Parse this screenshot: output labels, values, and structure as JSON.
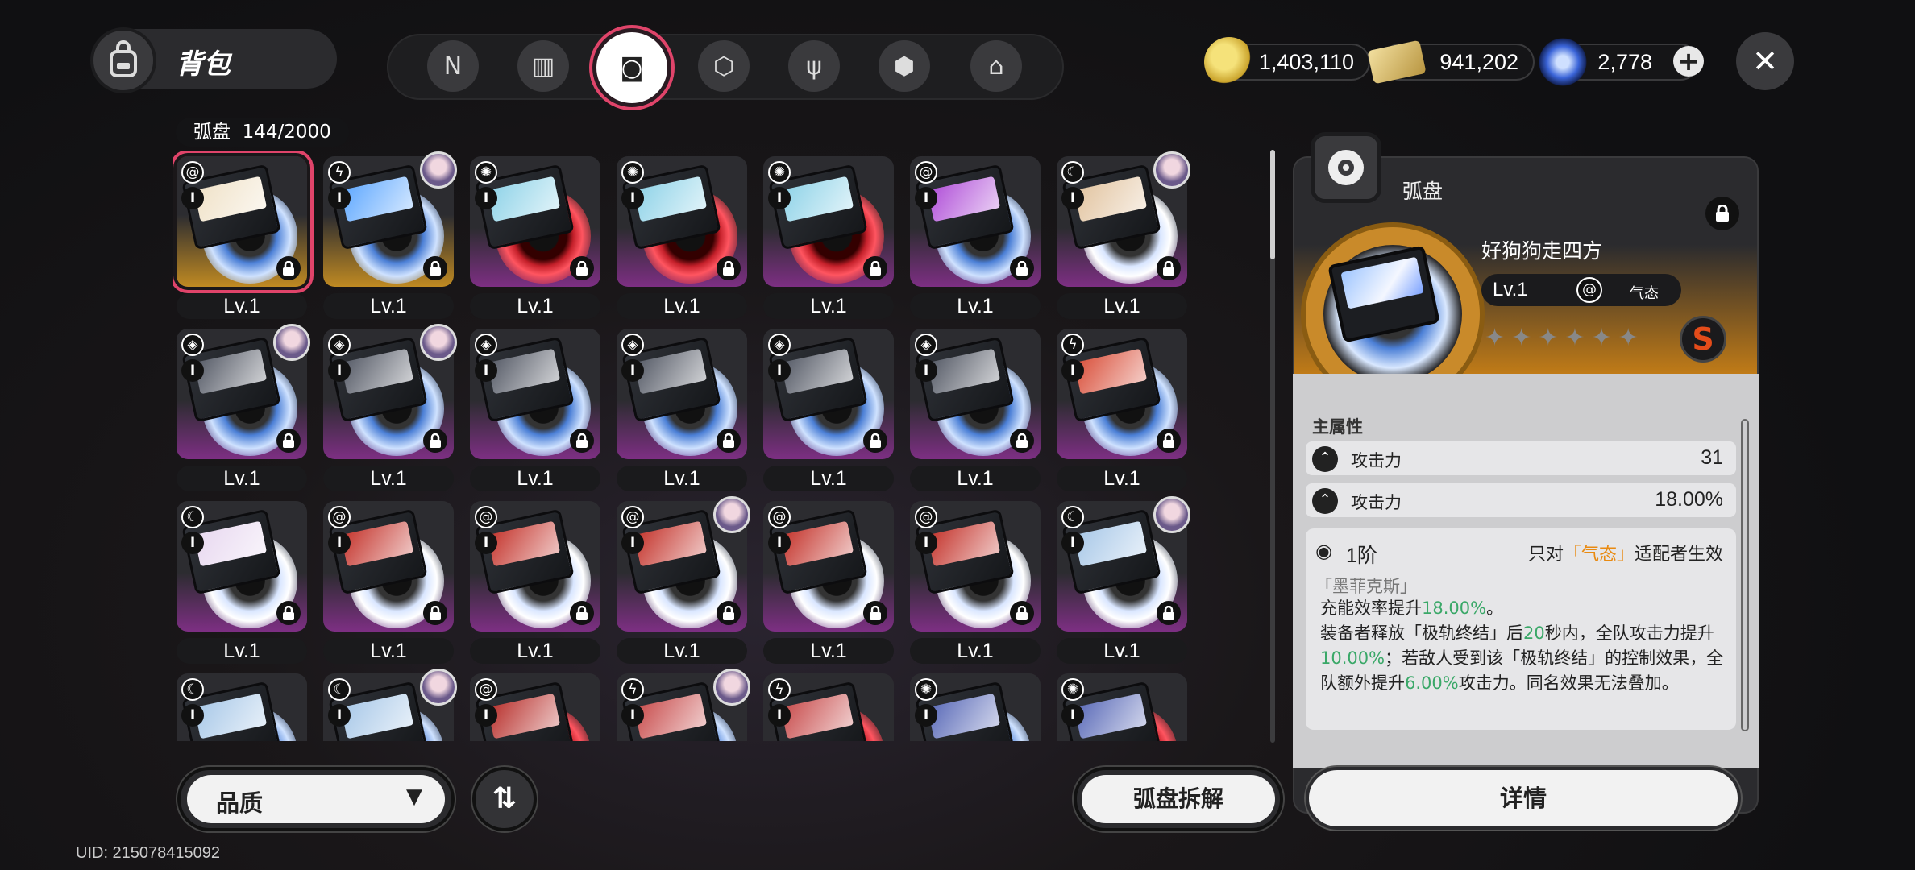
{
  "header": {
    "title": "背包",
    "tabs": [
      {
        "icon": "logo-n-icon",
        "glyph": "N"
      },
      {
        "icon": "gameboy-icon",
        "glyph": "▥"
      },
      {
        "icon": "disc-cartridge-icon",
        "glyph": "◙",
        "active": true
      },
      {
        "icon": "cube-icon",
        "glyph": "⬡"
      },
      {
        "icon": "utensils-icon",
        "glyph": "ψ"
      },
      {
        "icon": "crate-icon",
        "glyph": "⬢"
      },
      {
        "icon": "home-icon",
        "glyph": "⌂"
      }
    ]
  },
  "currency": {
    "gold": "1,403,110",
    "ticket": "941,202",
    "crystal": "2,778",
    "plus": "+",
    "close": "✕"
  },
  "inventory": {
    "category": "弧盘",
    "count": "144/2000",
    "level_label": "Lv.1",
    "rank": "I",
    "rows": [
      [
        {
          "attr": "swirl",
          "color": "gold",
          "disc": "blue",
          "label": "#f0e2c8",
          "selected": true
        },
        {
          "attr": "bolt",
          "color": "gold",
          "disc": "blue",
          "label": "#5fa8ff",
          "avatar": true
        },
        {
          "attr": "gear",
          "color": "purple",
          "disc": "red",
          "label": "#8fd3e8"
        },
        {
          "attr": "gear",
          "color": "purple",
          "disc": "red",
          "label": "#8fd3e8"
        },
        {
          "attr": "gear",
          "color": "purple",
          "disc": "red",
          "label": "#8fd3e8"
        },
        {
          "attr": "swirl",
          "color": "purple",
          "disc": "blue",
          "label": "#b04fd8"
        },
        {
          "attr": "moon",
          "color": "purple",
          "disc": "white",
          "label": "#e2c4a0",
          "avatar": true
        }
      ],
      [
        {
          "attr": "cube",
          "color": "purple",
          "disc": "blue",
          "label": "#555a66",
          "avatar": true
        },
        {
          "attr": "cube",
          "color": "purple",
          "disc": "blue",
          "label": "#555a66",
          "avatar": true
        },
        {
          "attr": "cube",
          "color": "purple",
          "disc": "blue",
          "label": "#555a66"
        },
        {
          "attr": "cube",
          "color": "purple",
          "disc": "blue",
          "label": "#555a66"
        },
        {
          "attr": "cube",
          "color": "purple",
          "disc": "blue",
          "label": "#555a66"
        },
        {
          "attr": "cube",
          "color": "purple",
          "disc": "blue",
          "label": "#555a66"
        },
        {
          "attr": "bolt",
          "color": "purple",
          "disc": "blue",
          "label": "#d94f3a"
        }
      ],
      [
        {
          "attr": "moon",
          "color": "purple",
          "disc": "white",
          "label": "#e8d8f0"
        },
        {
          "attr": "swirl",
          "color": "purple",
          "disc": "white",
          "label": "#c4342c"
        },
        {
          "attr": "swirl",
          "color": "purple",
          "disc": "white",
          "label": "#c4342c"
        },
        {
          "attr": "swirl",
          "color": "purple",
          "disc": "white",
          "label": "#c4342c",
          "avatar": true
        },
        {
          "attr": "swirl",
          "color": "purple",
          "disc": "white",
          "label": "#c4342c"
        },
        {
          "attr": "swirl",
          "color": "purple",
          "disc": "white",
          "label": "#c4342c"
        },
        {
          "attr": "moon",
          "color": "purple",
          "disc": "white",
          "label": "#a8c8e8",
          "avatar": true
        }
      ],
      [
        {
          "attr": "moon",
          "color": "purple",
          "disc": "blue",
          "label": "#a8c8e8"
        },
        {
          "attr": "moon",
          "color": "purple",
          "disc": "blue",
          "label": "#a8c8e8",
          "avatar": true
        },
        {
          "attr": "swirl",
          "color": "purple",
          "disc": "red",
          "label": "#b8302c"
        },
        {
          "attr": "bolt",
          "color": "purple",
          "disc": "blue",
          "label": "#c84c4c",
          "avatar": true
        },
        {
          "attr": "bolt",
          "color": "purple",
          "disc": "red",
          "label": "#c84c4c"
        },
        {
          "attr": "gear",
          "color": "purple",
          "disc": "blue",
          "label": "#5a6ab8"
        },
        {
          "attr": "gear",
          "color": "purple",
          "disc": "red",
          "label": "#5a6ab8"
        }
      ]
    ]
  },
  "controls": {
    "quality": "品质",
    "sort": "⇅",
    "dismantle": "弧盘拆解",
    "uid": "UID: 215078415092"
  },
  "detail": {
    "type": "弧盘",
    "name": "好狗狗走四方",
    "level": "Lv.1",
    "attribute": "气态",
    "stars": "✦✦✦✦✦✦",
    "rank": "S",
    "main_attr_title": "主属性",
    "stats": [
      {
        "name": "攻击力",
        "value": "31"
      },
      {
        "name": "攻击力",
        "value": "18.00%"
      }
    ],
    "set": {
      "tier": "1阶",
      "cond_pre": "只对",
      "cond_hl": "「气态」",
      "cond_post": "适配者生效",
      "name": "「墨菲克斯」",
      "line1_pre": "充能效率提升",
      "line1_hl": "18.00%",
      "line1_post": "。",
      "line2_pre": "装备者释放「极轨终结」后",
      "line2_hl1": "20",
      "line2_mid": "秒内，全队攻击力提升",
      "line2_hl2": "10.00%",
      "line2_mid2": "；若敌人受到该「极轨终结」的控制效果，全队额外提升",
      "line2_hl3": "6.00%",
      "line2_post": "攻击力。同名效果无法叠加。"
    },
    "details_button": "详情"
  },
  "colors": {
    "accent_pink": "#e0446a",
    "highlight_green": "#3aa868",
    "highlight_orange": "#e98a11"
  }
}
